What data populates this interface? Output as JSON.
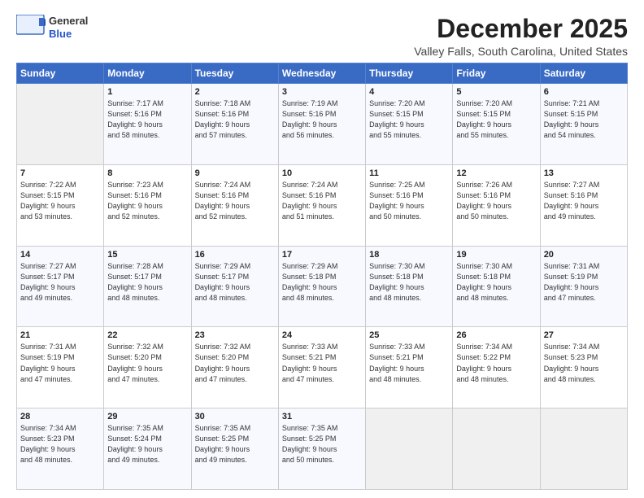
{
  "logo": {
    "line1": "General",
    "line2": "Blue"
  },
  "header": {
    "month": "December 2025",
    "location": "Valley Falls, South Carolina, United States"
  },
  "weekdays": [
    "Sunday",
    "Monday",
    "Tuesday",
    "Wednesday",
    "Thursday",
    "Friday",
    "Saturday"
  ],
  "weeks": [
    [
      {
        "day": "",
        "info": ""
      },
      {
        "day": "1",
        "info": "Sunrise: 7:17 AM\nSunset: 5:16 PM\nDaylight: 9 hours\nand 58 minutes."
      },
      {
        "day": "2",
        "info": "Sunrise: 7:18 AM\nSunset: 5:16 PM\nDaylight: 9 hours\nand 57 minutes."
      },
      {
        "day": "3",
        "info": "Sunrise: 7:19 AM\nSunset: 5:16 PM\nDaylight: 9 hours\nand 56 minutes."
      },
      {
        "day": "4",
        "info": "Sunrise: 7:20 AM\nSunset: 5:15 PM\nDaylight: 9 hours\nand 55 minutes."
      },
      {
        "day": "5",
        "info": "Sunrise: 7:20 AM\nSunset: 5:15 PM\nDaylight: 9 hours\nand 55 minutes."
      },
      {
        "day": "6",
        "info": "Sunrise: 7:21 AM\nSunset: 5:15 PM\nDaylight: 9 hours\nand 54 minutes."
      }
    ],
    [
      {
        "day": "7",
        "info": "Sunrise: 7:22 AM\nSunset: 5:15 PM\nDaylight: 9 hours\nand 53 minutes."
      },
      {
        "day": "8",
        "info": "Sunrise: 7:23 AM\nSunset: 5:16 PM\nDaylight: 9 hours\nand 52 minutes."
      },
      {
        "day": "9",
        "info": "Sunrise: 7:24 AM\nSunset: 5:16 PM\nDaylight: 9 hours\nand 52 minutes."
      },
      {
        "day": "10",
        "info": "Sunrise: 7:24 AM\nSunset: 5:16 PM\nDaylight: 9 hours\nand 51 minutes."
      },
      {
        "day": "11",
        "info": "Sunrise: 7:25 AM\nSunset: 5:16 PM\nDaylight: 9 hours\nand 50 minutes."
      },
      {
        "day": "12",
        "info": "Sunrise: 7:26 AM\nSunset: 5:16 PM\nDaylight: 9 hours\nand 50 minutes."
      },
      {
        "day": "13",
        "info": "Sunrise: 7:27 AM\nSunset: 5:16 PM\nDaylight: 9 hours\nand 49 minutes."
      }
    ],
    [
      {
        "day": "14",
        "info": "Sunrise: 7:27 AM\nSunset: 5:17 PM\nDaylight: 9 hours\nand 49 minutes."
      },
      {
        "day": "15",
        "info": "Sunrise: 7:28 AM\nSunset: 5:17 PM\nDaylight: 9 hours\nand 48 minutes."
      },
      {
        "day": "16",
        "info": "Sunrise: 7:29 AM\nSunset: 5:17 PM\nDaylight: 9 hours\nand 48 minutes."
      },
      {
        "day": "17",
        "info": "Sunrise: 7:29 AM\nSunset: 5:18 PM\nDaylight: 9 hours\nand 48 minutes."
      },
      {
        "day": "18",
        "info": "Sunrise: 7:30 AM\nSunset: 5:18 PM\nDaylight: 9 hours\nand 48 minutes."
      },
      {
        "day": "19",
        "info": "Sunrise: 7:30 AM\nSunset: 5:18 PM\nDaylight: 9 hours\nand 48 minutes."
      },
      {
        "day": "20",
        "info": "Sunrise: 7:31 AM\nSunset: 5:19 PM\nDaylight: 9 hours\nand 47 minutes."
      }
    ],
    [
      {
        "day": "21",
        "info": "Sunrise: 7:31 AM\nSunset: 5:19 PM\nDaylight: 9 hours\nand 47 minutes."
      },
      {
        "day": "22",
        "info": "Sunrise: 7:32 AM\nSunset: 5:20 PM\nDaylight: 9 hours\nand 47 minutes."
      },
      {
        "day": "23",
        "info": "Sunrise: 7:32 AM\nSunset: 5:20 PM\nDaylight: 9 hours\nand 47 minutes."
      },
      {
        "day": "24",
        "info": "Sunrise: 7:33 AM\nSunset: 5:21 PM\nDaylight: 9 hours\nand 47 minutes."
      },
      {
        "day": "25",
        "info": "Sunrise: 7:33 AM\nSunset: 5:21 PM\nDaylight: 9 hours\nand 48 minutes."
      },
      {
        "day": "26",
        "info": "Sunrise: 7:34 AM\nSunset: 5:22 PM\nDaylight: 9 hours\nand 48 minutes."
      },
      {
        "day": "27",
        "info": "Sunrise: 7:34 AM\nSunset: 5:23 PM\nDaylight: 9 hours\nand 48 minutes."
      }
    ],
    [
      {
        "day": "28",
        "info": "Sunrise: 7:34 AM\nSunset: 5:23 PM\nDaylight: 9 hours\nand 48 minutes."
      },
      {
        "day": "29",
        "info": "Sunrise: 7:35 AM\nSunset: 5:24 PM\nDaylight: 9 hours\nand 49 minutes."
      },
      {
        "day": "30",
        "info": "Sunrise: 7:35 AM\nSunset: 5:25 PM\nDaylight: 9 hours\nand 49 minutes."
      },
      {
        "day": "31",
        "info": "Sunrise: 7:35 AM\nSunset: 5:25 PM\nDaylight: 9 hours\nand 50 minutes."
      },
      {
        "day": "",
        "info": ""
      },
      {
        "day": "",
        "info": ""
      },
      {
        "day": "",
        "info": ""
      }
    ]
  ]
}
